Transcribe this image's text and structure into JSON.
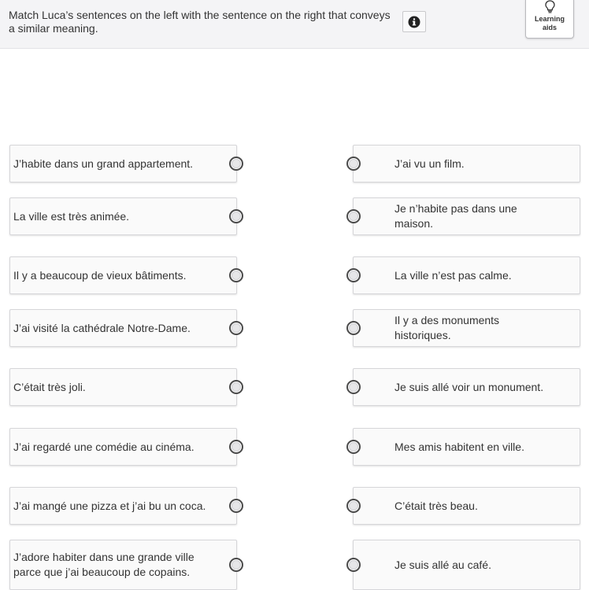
{
  "header": {
    "instructions": "Match Luca’s sentences on the left with the sentence on the right that conveys a similar meaning.",
    "info_icon": "info-icon",
    "learning_aids_label": "Learning\naids",
    "learning_aids_icon": "lightbulb-icon"
  },
  "left_items": [
    "J’habite dans un grand appartement.",
    "La ville est très animée.",
    "Il y a beaucoup de vieux bâtiments.",
    "J’ai visité la cathédrale Notre-Dame.",
    "C’était très joli.",
    "J’ai regardé une comédie au cinéma.",
    "J’ai mangé une pizza et j’ai bu un coca.",
    "J’adore habiter dans une grande ville parce que j’ai beaucoup de copains."
  ],
  "right_items": [
    "J’ai vu un film.",
    "Je n’habite pas dans une maison.",
    "La ville n’est pas calme.",
    "Il y a des monuments historiques.",
    "Je suis allé voir un monument.",
    "Mes amis habitent en ville.",
    "C’était très beau.",
    "Je suis allé au café."
  ]
}
